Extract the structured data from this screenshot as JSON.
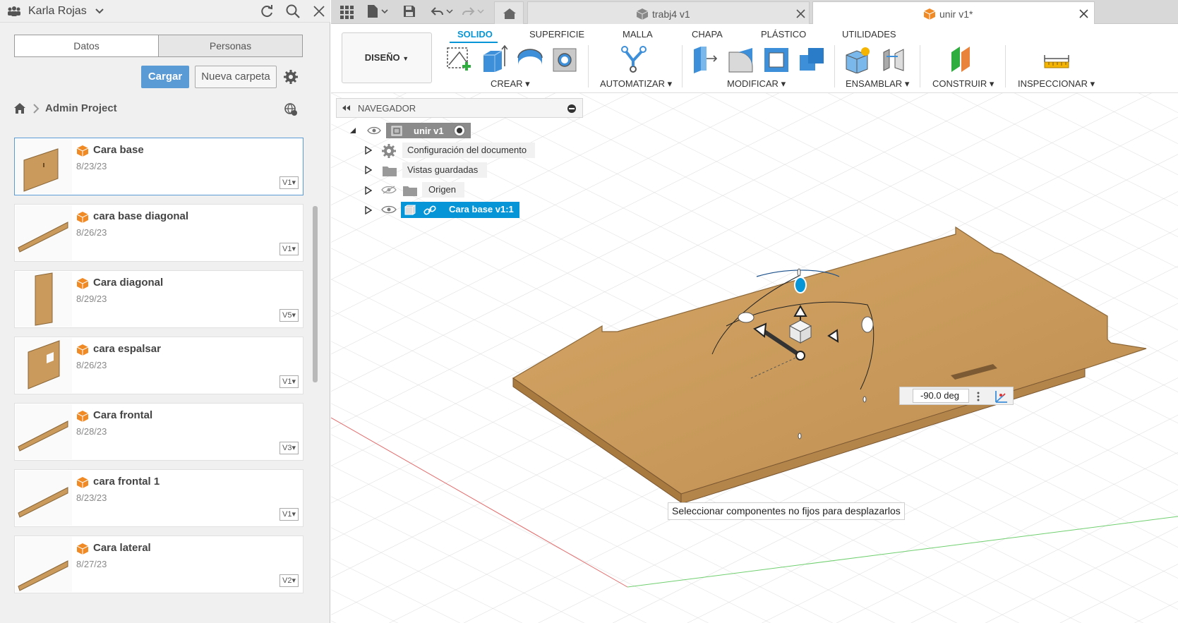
{
  "left_panel": {
    "user": "Karla Rojas",
    "tabs": [
      {
        "label": "Datos"
      },
      {
        "label": "Personas"
      }
    ],
    "upload_label": "Cargar",
    "new_folder_label": "Nueva carpeta",
    "breadcrumb": "Admin Project",
    "files": [
      {
        "name": "Cara base",
        "date": "8/23/23",
        "version": "V1"
      },
      {
        "name": "cara base diagonal",
        "date": "8/26/23",
        "version": "V1"
      },
      {
        "name": "Cara diagonal",
        "date": "8/29/23",
        "version": "V5"
      },
      {
        "name": "cara espalsar",
        "date": "8/26/23",
        "version": "V1"
      },
      {
        "name": "Cara frontal",
        "date": "8/28/23",
        "version": "V3"
      },
      {
        "name": "cara frontal 1",
        "date": "8/23/23",
        "version": "V1"
      },
      {
        "name": "Cara lateral",
        "date": "8/27/23",
        "version": "V2"
      }
    ]
  },
  "doc_tabs": [
    {
      "label": "trabj4 v1"
    },
    {
      "label": "unir v1*"
    }
  ],
  "toolbar": {
    "workspace": "DISEÑO",
    "tabs": [
      {
        "label": "SOLIDO"
      },
      {
        "label": "SUPERFICIE"
      },
      {
        "label": "MALLA"
      },
      {
        "label": "CHAPA"
      },
      {
        "label": "PLÁSTICO"
      },
      {
        "label": "UTILIDADES"
      }
    ],
    "groups": [
      {
        "label": "CREAR"
      },
      {
        "label": "AUTOMATIZAR"
      },
      {
        "label": "MODIFICAR"
      },
      {
        "label": "ENSAMBLAR"
      },
      {
        "label": "CONSTRUIR"
      },
      {
        "label": "INSPECCIONAR"
      }
    ]
  },
  "browser": {
    "title": "NAVEGADOR",
    "root": "unir v1",
    "items": [
      {
        "label": "Configuración del documento"
      },
      {
        "label": "Vistas guardadas"
      },
      {
        "label": "Origen"
      },
      {
        "label": "Cara base v1:1"
      }
    ]
  },
  "angle_value": "-90.0 deg",
  "status_tip": "Seleccionar componentes no fijos para desplazarlos",
  "colors": {
    "accent": "#0696d7",
    "upload_button": "#5a9bd5",
    "wood": "#c99a5b",
    "cube_orange": "#f08a24"
  }
}
